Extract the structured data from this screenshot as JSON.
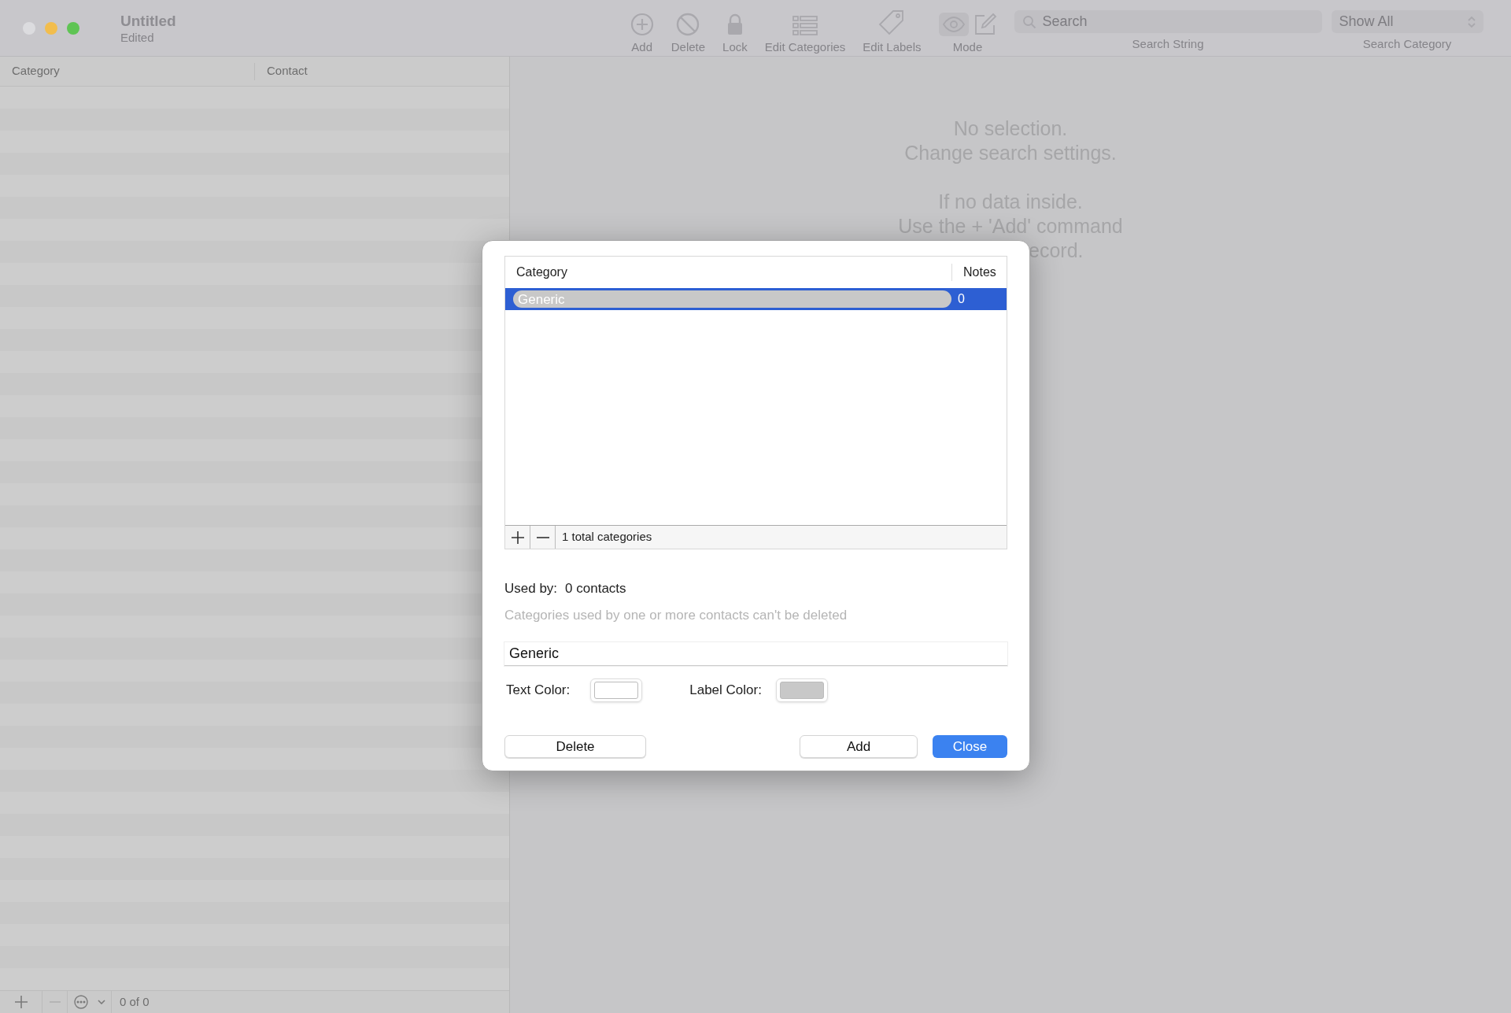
{
  "window": {
    "title": "Untitled",
    "subtitle": "Edited"
  },
  "toolbar": {
    "items": [
      {
        "kind": "add",
        "label": "Add"
      },
      {
        "kind": "delete",
        "label": "Delete"
      },
      {
        "kind": "lock",
        "label": "Lock"
      },
      {
        "kind": "categories",
        "label": "Edit Categories"
      },
      {
        "kind": "labels",
        "label": "Edit Labels"
      },
      {
        "kind": "mode",
        "label": "Mode"
      }
    ],
    "search": {
      "placeholder": "Search",
      "label": "Search String"
    },
    "category_popup": {
      "value": "Show All",
      "label": "Search Category"
    }
  },
  "list": {
    "columns": [
      "Category",
      "Contact"
    ]
  },
  "bottom_bar": {
    "count": "0 of 0"
  },
  "empty_state": {
    "lines": [
      "No selection.",
      "Change search settings.",
      "If no data inside.",
      "Use the + 'Add' command",
      "ecord."
    ]
  },
  "dialog": {
    "table": {
      "columns": [
        "Category",
        "Notes"
      ],
      "rows": [
        {
          "category": "Generic",
          "notes": "0",
          "selected": true
        }
      ]
    },
    "footer": "1 total categories",
    "used_by_label": "Used by:",
    "used_by_value": "0 contacts",
    "hint": "Categories used by one or more contacts can't be deleted",
    "name_field": {
      "value": "Generic"
    },
    "text_color": {
      "label": "Text Color:",
      "color": "#ffffff"
    },
    "label_color": {
      "label": "Label Color:",
      "color": "#c8c8c8"
    },
    "buttons": [
      {
        "label": "Delete",
        "kind": "default"
      },
      {
        "label": "Add",
        "kind": "default"
      },
      {
        "label": "Close",
        "kind": "primary"
      }
    ]
  }
}
